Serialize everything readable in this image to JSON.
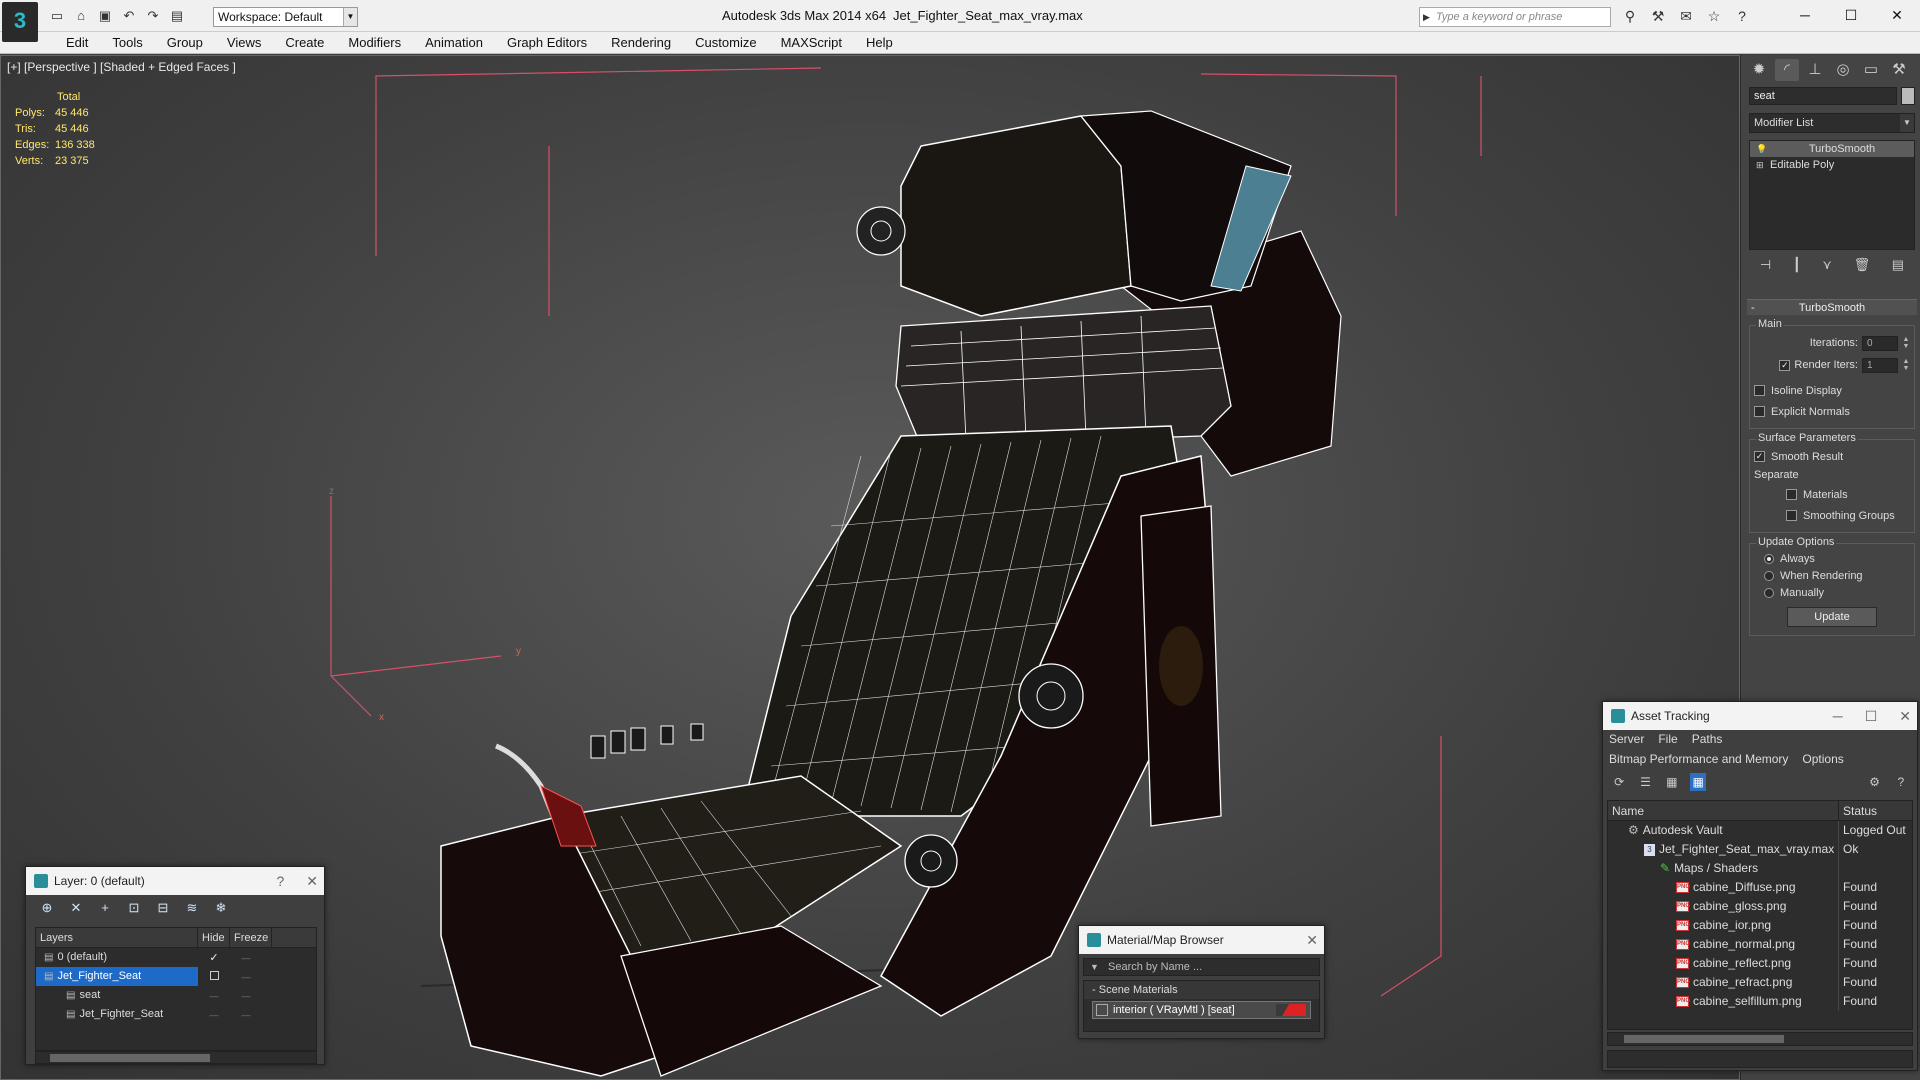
{
  "app": {
    "logo": "3",
    "workspace": "Workspace: Default",
    "title": "Autodesk 3ds Max  2014 x64",
    "file": "Jet_Fighter_Seat_max_vray.max",
    "search_placeholder": "Type a keyword or phrase"
  },
  "menu": [
    "Edit",
    "Tools",
    "Group",
    "Views",
    "Create",
    "Modifiers",
    "Animation",
    "Graph Editors",
    "Rendering",
    "Customize",
    "MAXScript",
    "Help"
  ],
  "viewport": {
    "label": "[+] [Perspective ] [Shaded + Edged Faces ]",
    "stats_header": "Total",
    "stats": [
      {
        "k": "Polys:",
        "v": "45 446"
      },
      {
        "k": "Tris:",
        "v": "45 446"
      },
      {
        "k": "Edges:",
        "v": "136 338"
      },
      {
        "k": "Verts:",
        "v": "23 375"
      }
    ]
  },
  "command_panel": {
    "object_name": "seat",
    "modifier_list": "Modifier List",
    "stack": [
      "TurboSmooth",
      "Editable Poly"
    ],
    "rollout": "TurboSmooth",
    "main_label": "Main",
    "iterations_label": "Iterations:",
    "iterations_value": "0",
    "render_iters_label": "Render Iters:",
    "render_iters_value": "1",
    "isoline": "Isoline Display",
    "explicit_normals": "Explicit Normals",
    "surface_params": "Surface Parameters",
    "smooth_result": "Smooth Result",
    "separate": "Separate",
    "materials": "Materials",
    "smoothing_groups": "Smoothing Groups",
    "update_options": "Update Options",
    "always": "Always",
    "when_rendering": "When Rendering",
    "manually": "Manually",
    "update": "Update"
  },
  "layers_window": {
    "title": "Layer: 0 (default)",
    "help": "?",
    "col_layers": "Layers",
    "col_hide": "Hide",
    "col_freeze": "Freeze",
    "rows": [
      {
        "name": "0 (default)",
        "indent": 1
      },
      {
        "name": "Jet_Fighter_Seat",
        "indent": 1
      },
      {
        "name": "seat",
        "indent": 2
      },
      {
        "name": "Jet_Fighter_Seat",
        "indent": 2
      }
    ]
  },
  "material_browser": {
    "title": "Material/Map Browser",
    "search": "Search by Name ...",
    "category": "Scene Materials",
    "item": "interior  ( VRayMtl )  [seat]"
  },
  "asset_tracking": {
    "title": "Asset Tracking",
    "menu": [
      "Server",
      "File",
      "Paths"
    ],
    "menu2": [
      "Bitmap Performance and Memory",
      "Options"
    ],
    "col_name": "Name",
    "col_status": "Status",
    "rows": [
      {
        "name": "Autodesk Vault",
        "status": "Logged Out",
        "indent": 1,
        "icon": "vault"
      },
      {
        "name": "Jet_Fighter_Seat_max_vray.max",
        "status": "Ok",
        "indent": 2,
        "icon": "max"
      },
      {
        "name": "Maps / Shaders",
        "status": "",
        "indent": 3,
        "icon": "maps"
      },
      {
        "name": "cabine_Diffuse.png",
        "status": "Found",
        "indent": 4,
        "icon": "png"
      },
      {
        "name": "cabine_gloss.png",
        "status": "Found",
        "indent": 4,
        "icon": "png"
      },
      {
        "name": "cabine_ior.png",
        "status": "Found",
        "indent": 4,
        "icon": "png"
      },
      {
        "name": "cabine_normal.png",
        "status": "Found",
        "indent": 4,
        "icon": "png"
      },
      {
        "name": "cabine_reflect.png",
        "status": "Found",
        "indent": 4,
        "icon": "png"
      },
      {
        "name": "cabine_refract.png",
        "status": "Found",
        "indent": 4,
        "icon": "png"
      },
      {
        "name": "cabine_selfillum.png",
        "status": "Found",
        "indent": 4,
        "icon": "png"
      }
    ]
  },
  "colors": {
    "accent": "#2fb8c8",
    "selection": "#1e6ac8",
    "stats_text": "#ffe86a",
    "wire": "#ffffff",
    "grid_box": "#d6506a"
  }
}
